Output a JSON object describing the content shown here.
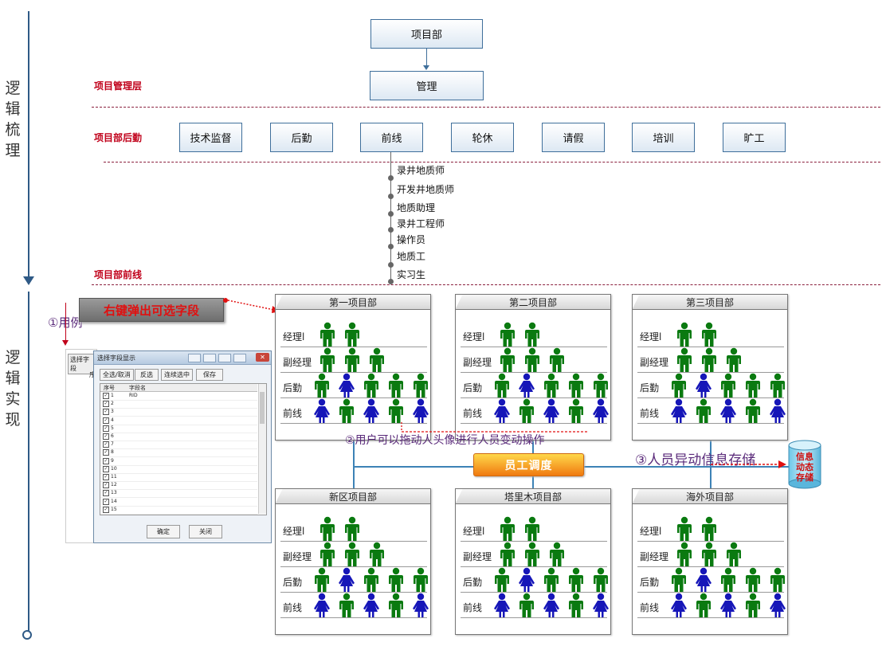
{
  "sections": {
    "logic_sort": [
      "逻",
      "辑",
      "梳",
      "理"
    ],
    "logic_impl": [
      "逻",
      "辑",
      "实",
      "现"
    ]
  },
  "layers": {
    "management": "项目管理层",
    "support": "项目部后勤",
    "frontline": "项目部前线"
  },
  "top_boxes": {
    "project_dept": "项目部",
    "management": "管理"
  },
  "support_boxes": [
    "技术监督",
    "后勤",
    "前线",
    "轮休",
    "请假",
    "培训",
    "旷工"
  ],
  "frontline_roles": [
    "录井地质师",
    "开发井地质师",
    "地质助理",
    "录井工程师",
    "操作员",
    "地质工",
    "实习生"
  ],
  "annotations": {
    "use_case": "①用例",
    "right_click": "右键弹出可选字段",
    "drag": "②用户可以拖动人头像进行人员变动操作",
    "store": "③人员异动信息存储",
    "dispatch": "员工调度",
    "db": [
      "信息",
      "动态",
      "存储"
    ]
  },
  "depts": [
    {
      "name": "第一项目部"
    },
    {
      "name": "第二项目部"
    },
    {
      "name": "第三项目部"
    },
    {
      "name": "新区项目部"
    },
    {
      "name": "塔里木项目部"
    },
    {
      "name": "海外项目部"
    }
  ],
  "dept_rows": [
    {
      "label": "经理l",
      "people": [
        "green",
        "green"
      ]
    },
    {
      "label": "副经理",
      "people": [
        "green",
        "green",
        "green"
      ]
    },
    {
      "label": "后勤",
      "people": [
        "green",
        "blue",
        "green",
        "green",
        "green"
      ]
    },
    {
      "label": "前线",
      "people": [
        "blue",
        "green",
        "blue",
        "green",
        "blue"
      ]
    }
  ],
  "dialog": {
    "side_tab": "选择字段",
    "side_col": "序",
    "title": "选择字段显示",
    "buttons": [
      "全选/取消",
      "反选",
      "连续选中",
      "保存"
    ],
    "col_headers": [
      "序号",
      "字段名"
    ],
    "rows": [
      "1",
      "2",
      "3",
      "4",
      "5",
      "6",
      "7",
      "8",
      "9",
      "10",
      "11",
      "12",
      "13",
      "14",
      "15"
    ],
    "first_field": "RID",
    "ok": "确定",
    "close": "关闭"
  },
  "colors": {
    "green": "#0a7a10",
    "blue": "#1616b8",
    "accent_red": "#c0001a",
    "connector": "#3d82b6"
  }
}
